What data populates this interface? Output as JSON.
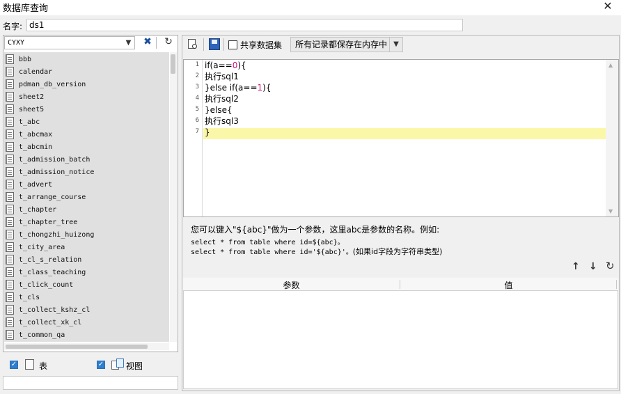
{
  "window": {
    "title": "数据库查询",
    "close_icon": "close-icon",
    "close_glyph": "✕"
  },
  "name_field": {
    "label": "名字:",
    "value": "ds1"
  },
  "left_panel": {
    "schema_select": {
      "value": "CYXY",
      "arrow": "▼"
    },
    "tool_icon": "tools-icon",
    "tool_glyph": "✖",
    "refresh_glyph": "↻",
    "tables": [
      "bbb",
      "calendar",
      "pdman_db_version",
      "sheet2",
      "sheet5",
      "t_abc",
      "t_abcmax",
      "t_abcmin",
      "t_admission_batch",
      "t_admission_notice",
      "t_advert",
      "t_arrange_course",
      "t_chapter",
      "t_chapter_tree",
      "t_chongzhi_huizong",
      "t_city_area",
      "t_cl_s_relation",
      "t_class_teaching",
      "t_click_count",
      "t_cls",
      "t_collect_kshz_cl",
      "t_collect_xk_cl",
      "t_common_qa"
    ],
    "filter": {
      "table_label": "表",
      "view_label": "视图",
      "check_glyph": "✓"
    }
  },
  "right_panel": {
    "toolbar": {
      "share_label": "共享数据集",
      "mode_value": "所有记录都保存在内存中",
      "mode_arrow": "▼"
    },
    "editor": {
      "line_numbers": [
        "1",
        "2",
        "3",
        "4",
        "5",
        "6",
        "7"
      ],
      "lines": [
        {
          "pre": "if(a==",
          "num": "0",
          "post": "){"
        },
        {
          "pre": "执行sql1",
          "num": "",
          "post": ""
        },
        {
          "pre": "}else if(a==",
          "num": "1",
          "post": "){"
        },
        {
          "pre": "执行sql2",
          "num": "",
          "post": ""
        },
        {
          "pre": "}else{",
          "num": "",
          "post": ""
        },
        {
          "pre": "执行sql3",
          "num": "",
          "post": ""
        },
        {
          "pre": "}",
          "num": "",
          "post": ""
        }
      ],
      "scroll_up": "▲",
      "scroll_down": "▼"
    },
    "hint": {
      "line1": "您可以键入\"${abc}\"做为一个参数，这里abc是参数的名称。例如:",
      "line2": "select * from table where id=${abc}。",
      "line3_code": "select * from table where id='${abc}'。",
      "line3_note": "(如果id字段为字符串类型)"
    },
    "param_buttons": {
      "up": "↑",
      "down": "↓",
      "reset": "↻"
    },
    "param_table": {
      "columns": [
        "参数",
        "值"
      ]
    }
  },
  "colors": {
    "active_line": "#fbf7a8",
    "number": "#d0107e",
    "checkbox": "#2d7fd0",
    "tree_bg": "#e0e0e0"
  }
}
